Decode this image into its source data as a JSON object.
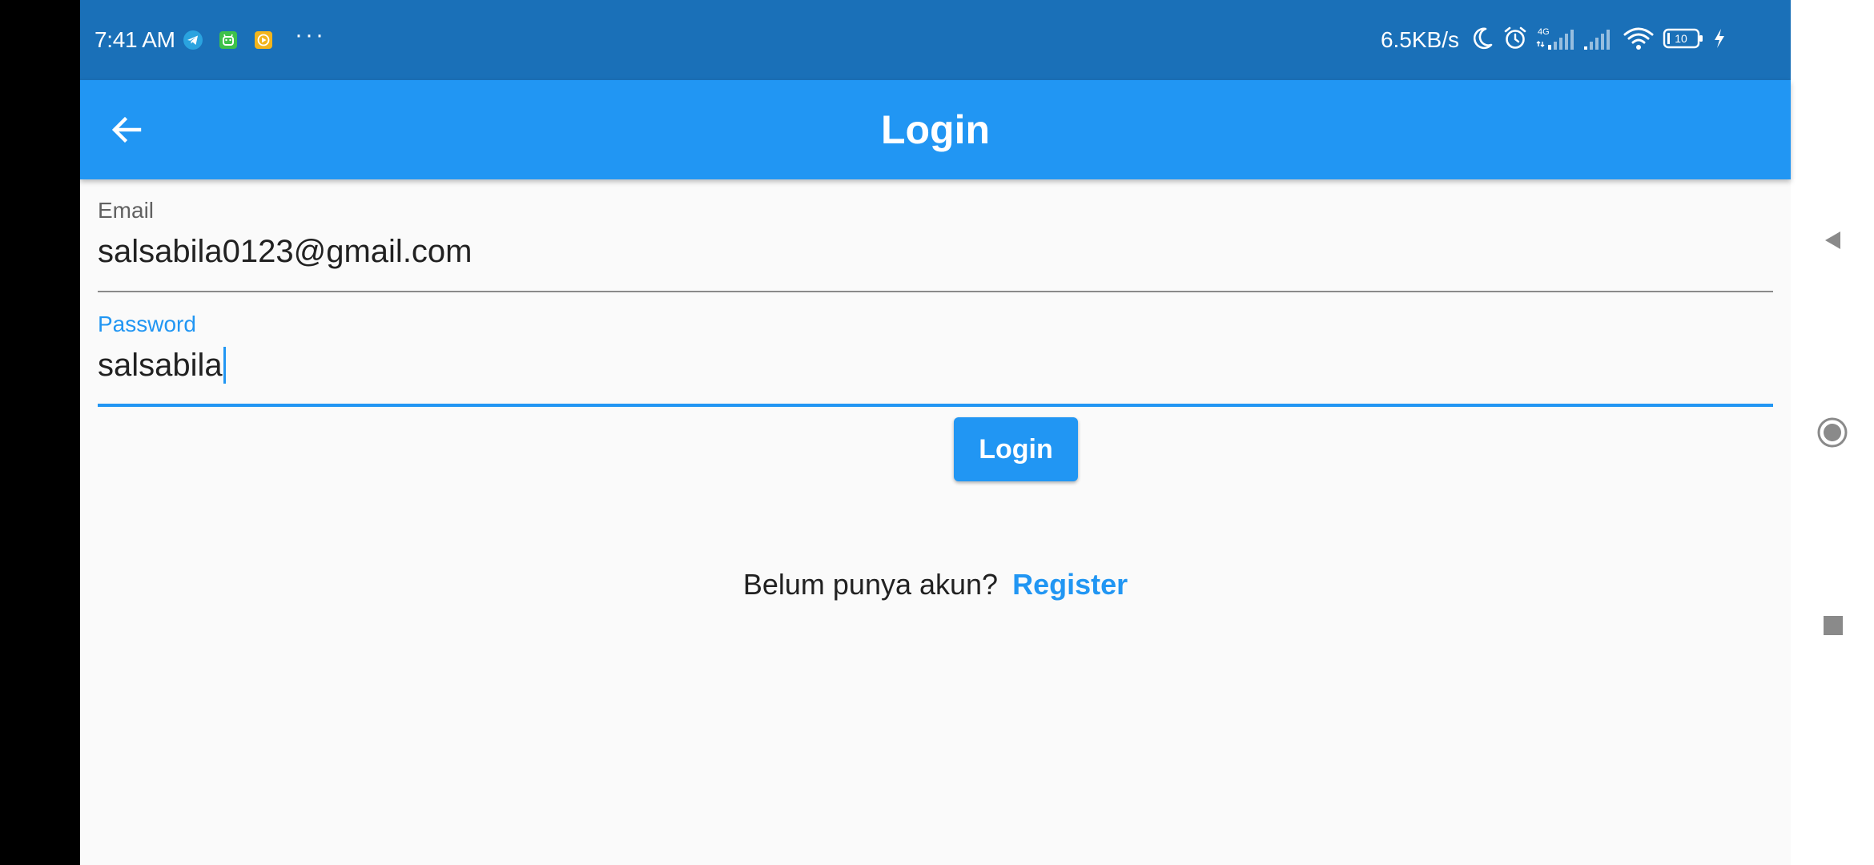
{
  "status_bar": {
    "time": "7:41 AM",
    "notification_icons": [
      "telegram-icon",
      "android-app-icon",
      "play-app-icon"
    ],
    "overflow_dots": "···",
    "net_speed": "6.5KB/s",
    "network_type": "4G",
    "battery_level": "10",
    "right_icons": [
      "moon-icon",
      "alarm-icon",
      "signal-4g-icon",
      "signal-icon",
      "wifi-icon",
      "battery-icon",
      "charging-icon"
    ],
    "background_color": "#1a70b8"
  },
  "app_bar": {
    "title": "Login",
    "back_icon": "arrow-back-icon",
    "background_color": "#2196f3"
  },
  "form": {
    "email": {
      "label": "Email",
      "value": "salsabila0123@gmail.com",
      "focused": false
    },
    "password": {
      "label": "Password",
      "value": "salsabila",
      "focused": true
    }
  },
  "login_button": {
    "label": "Login"
  },
  "register": {
    "prompt": "Belum punya akun?",
    "link": "Register"
  },
  "nav_bar": {
    "buttons": [
      "back-triangle-icon",
      "home-circle-icon",
      "recents-square-icon"
    ]
  },
  "colors": {
    "accent": "#2196f3",
    "status_bar": "#1a70b8",
    "background": "#fafafa"
  }
}
